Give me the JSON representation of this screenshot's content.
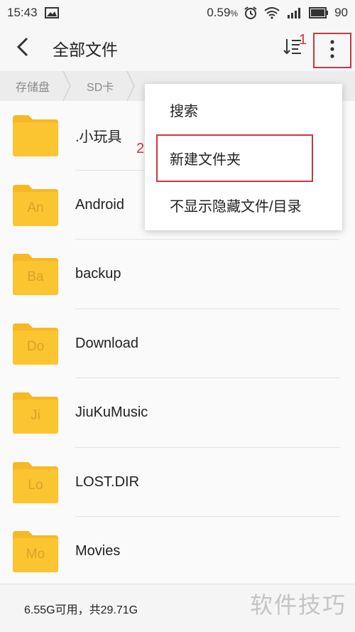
{
  "status_bar": {
    "time": "15:43",
    "battery_percent": "0.59",
    "battery_unit": "%",
    "battery_level": "90",
    "icons": [
      "image-icon",
      "alarm-icon",
      "wifi-icon",
      "signal-icon",
      "battery-icon"
    ]
  },
  "app_bar": {
    "title": "全部文件",
    "back_icon": "chevron-left-icon",
    "sort_icon": "sort-icon",
    "more_icon": "more-vertical-icon"
  },
  "annotations": {
    "step1": "1",
    "step2": "2",
    "highlight_color": "#c8383f"
  },
  "breadcrumb": {
    "items": [
      "存储盘",
      "SD卡"
    ]
  },
  "files": [
    {
      "name": ".小玩具",
      "abbr": ""
    },
    {
      "name": "Android",
      "abbr": "An"
    },
    {
      "name": "backup",
      "abbr": "Ba"
    },
    {
      "name": "Download",
      "abbr": "Do"
    },
    {
      "name": "JiuKuMusic",
      "abbr": "Ji"
    },
    {
      "name": "LOST.DIR",
      "abbr": "Lo"
    },
    {
      "name": "Movies",
      "abbr": "Mo"
    }
  ],
  "menu": {
    "items": [
      "搜索",
      "新建文件夹",
      "不显示隐藏文件/目录"
    ]
  },
  "footer": {
    "storage_text": "6.55G可用，共29.71G"
  },
  "watermark": "软件技巧",
  "colors": {
    "folder": "#fbc531",
    "folder_tab": "#f6b823",
    "accent": "#c8383f"
  }
}
